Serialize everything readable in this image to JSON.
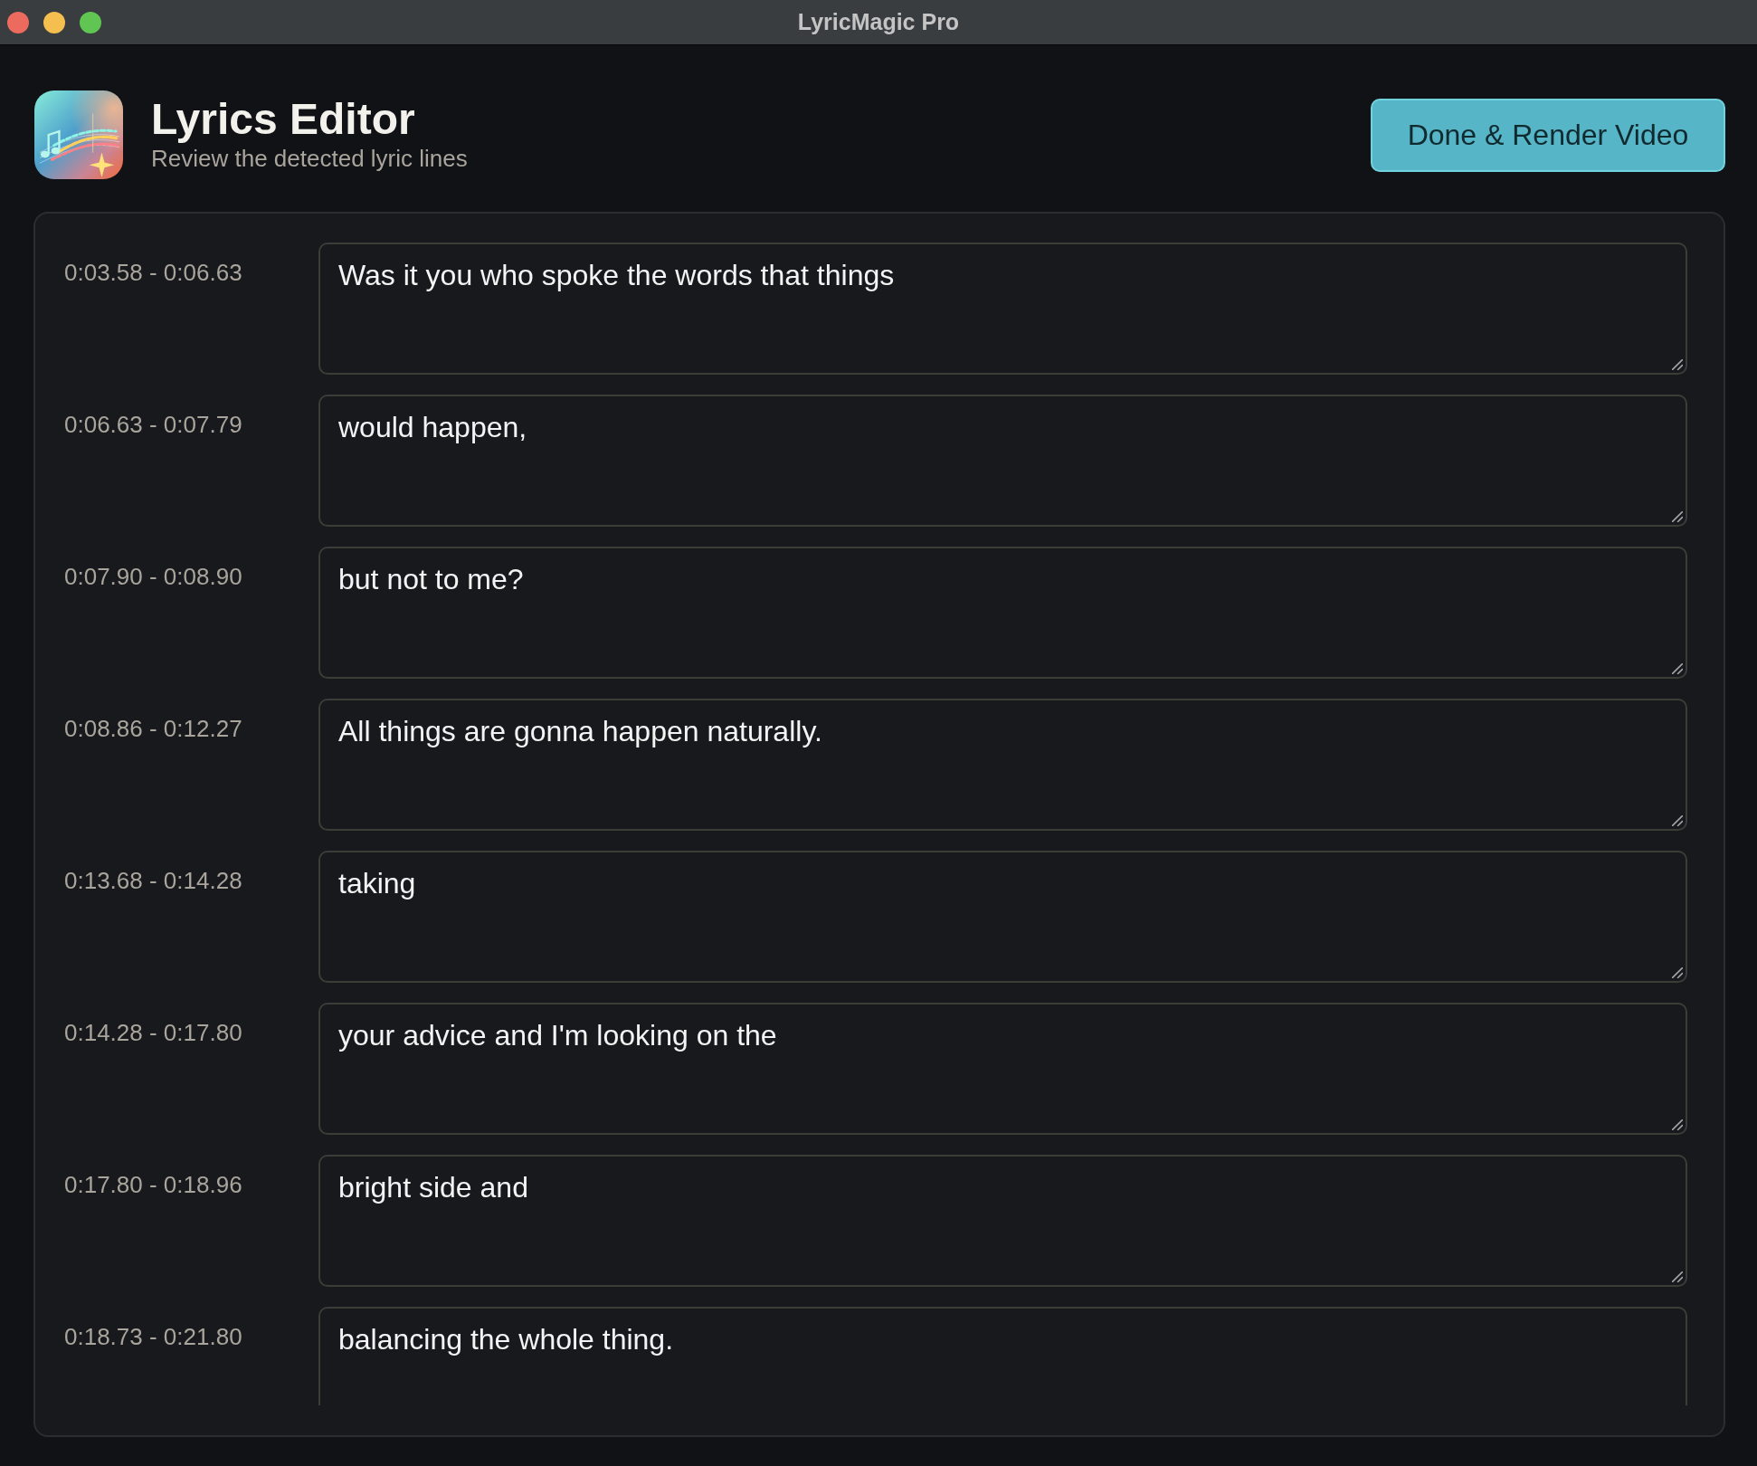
{
  "window": {
    "title": "LyricMagic Pro"
  },
  "header": {
    "title": "Lyrics Editor",
    "subtitle": "Review the detected lyric lines"
  },
  "primary_button": {
    "label": "Done & Render Video"
  },
  "lines": [
    {
      "time": "0:03.58 - 0:06.63",
      "text": "Was it you who spoke the words that things"
    },
    {
      "time": "0:06.63 - 0:07.79",
      "text": "would happen,"
    },
    {
      "time": "0:07.90 - 0:08.90",
      "text": "but not to me?"
    },
    {
      "time": "0:08.86 - 0:12.27",
      "text": "All things are gonna happen naturally."
    },
    {
      "time": "0:13.68 - 0:14.28",
      "text": "taking"
    },
    {
      "time": "0:14.28 - 0:17.80",
      "text": "your advice and I'm looking on the"
    },
    {
      "time": "0:17.80 - 0:18.96",
      "text": "bright side and"
    },
    {
      "time": "0:18.73 - 0:21.80",
      "text": "balancing the whole thing."
    }
  ]
}
